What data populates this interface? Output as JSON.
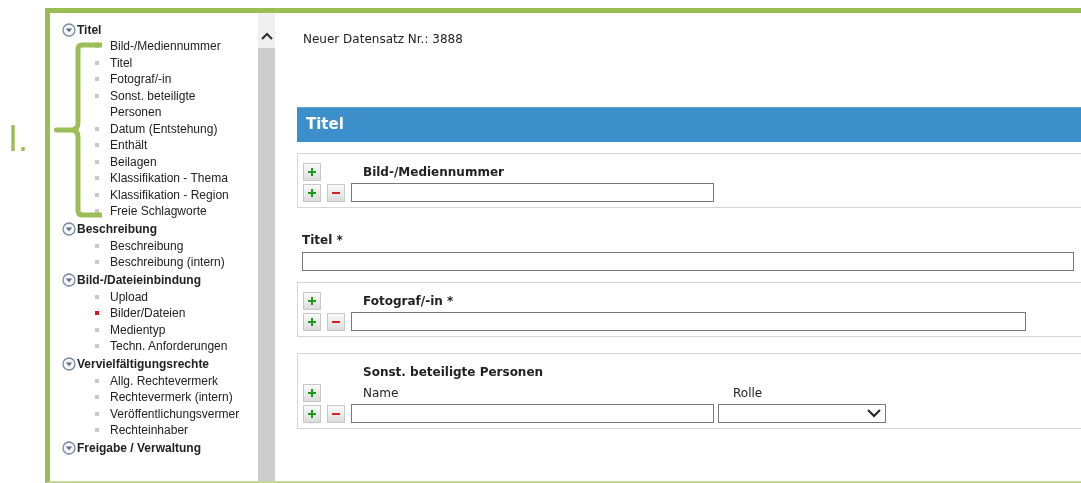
{
  "annotation": {
    "label": "I."
  },
  "sidebar": {
    "groups": [
      {
        "title": "Titel",
        "expanded": true,
        "items": [
          {
            "label": "Bild-/Mediennummer",
            "selected": false
          },
          {
            "label": "Titel",
            "selected": false
          },
          {
            "label": "Fotograf/-in",
            "selected": false
          },
          {
            "label": "Sonst. beteiligte Personen",
            "selected": false
          },
          {
            "label": "Datum (Entstehung)",
            "selected": false
          },
          {
            "label": "Enthält",
            "selected": false
          },
          {
            "label": "Beilagen",
            "selected": false
          },
          {
            "label": "Klassifikation - Thema",
            "selected": false
          },
          {
            "label": "Klassifikation - Region",
            "selected": false
          },
          {
            "label": "Freie Schlagworte",
            "selected": false
          }
        ]
      },
      {
        "title": "Beschreibung",
        "expanded": true,
        "items": [
          {
            "label": "Beschreibung",
            "selected": false
          },
          {
            "label": "Beschreibung (intern)",
            "selected": false
          }
        ]
      },
      {
        "title": "Bild-/Dateieinbindung",
        "expanded": true,
        "items": [
          {
            "label": "Upload",
            "selected": false
          },
          {
            "label": "Bilder/Dateien",
            "selected": true
          },
          {
            "label": "Medientyp",
            "selected": false
          },
          {
            "label": "Techn. Anforderungen",
            "selected": false
          }
        ]
      },
      {
        "title": "Vervielfältigungsrechte",
        "expanded": true,
        "items": [
          {
            "label": "Allg. Rechtevermerk",
            "selected": false
          },
          {
            "label": "Rechtevermerk (intern)",
            "selected": false
          },
          {
            "label": "Veröffentlichungsvermer",
            "selected": false
          },
          {
            "label": "Rechteinhaber",
            "selected": false
          }
        ]
      },
      {
        "title": "Freigabe / Verwaltung",
        "expanded": true
      }
    ]
  },
  "record_label": "Neuer Datensatz Nr.: 3888",
  "section_header": "Titel",
  "fields": [
    {
      "kind": "repeatable",
      "label": "Bild-/Mediennummer",
      "wide": false
    },
    {
      "kind": "plain",
      "label": "Titel *"
    },
    {
      "kind": "repeatable",
      "label": "Fotograf/-in *",
      "wide": true
    },
    {
      "kind": "person",
      "label": "Sonst. beteiligte Personen",
      "name_label": "Name",
      "role_label": "Rolle"
    }
  ]
}
